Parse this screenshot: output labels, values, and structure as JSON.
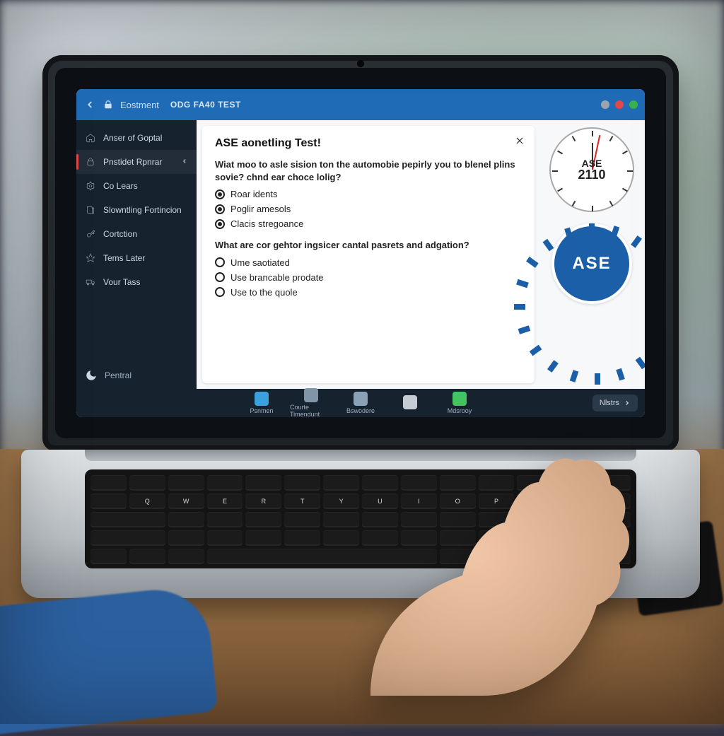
{
  "header": {
    "crumb": "Eostment",
    "title": "ODG FA40 TEST"
  },
  "window": {
    "controls": [
      "minimize",
      "maximize",
      "close"
    ]
  },
  "sidebar": {
    "items": [
      {
        "icon": "home-icon",
        "label": "Anser of Goptal"
      },
      {
        "icon": "lock-icon",
        "label": "Pnstidet Rpnrar",
        "active": true,
        "chevron": true
      },
      {
        "icon": "gear-icon",
        "label": "Co Lears"
      },
      {
        "icon": "book-icon",
        "label": "Slowntling Fortincion"
      },
      {
        "icon": "key-icon",
        "label": "Cortction"
      },
      {
        "icon": "star-icon",
        "label": "Tems Later"
      },
      {
        "icon": "truck-icon",
        "label": "Vour Tass"
      }
    ],
    "footer": {
      "icon": "moon-icon",
      "label": "Pentral"
    }
  },
  "card": {
    "title": "ASE aonetling Test!",
    "questions": [
      {
        "text": "Wiat moo to asle sision ton the automobie pepirly you to blenel plins sovie? chnd ear choce lolig?",
        "options": [
          {
            "label": "Roar idents",
            "checked": true
          },
          {
            "label": "Poglir amesols",
            "checked": true
          },
          {
            "label": "Clacis stregoance",
            "checked": true
          }
        ]
      },
      {
        "text": "What are cor gehtor ingsicer cantal pasrets and adgation?",
        "options": [
          {
            "label": "Ume saotiated",
            "checked": false
          },
          {
            "label": "Use brancable prodate",
            "checked": false
          },
          {
            "label": "Use to the quole",
            "checked": false
          }
        ]
      }
    ]
  },
  "clock": {
    "label1": "ASE",
    "label2": "2110"
  },
  "seal": {
    "label": "ASE"
  },
  "taskbar": {
    "apps": [
      {
        "icon": "folder-icon",
        "label": "Psnmen",
        "color": "#3aa1de"
      },
      {
        "icon": "calendar-icon",
        "label": "Courte Timendunt",
        "color": "#8095a8"
      },
      {
        "icon": "list-icon",
        "label": "Bswodere",
        "color": "#8aa1b6"
      },
      {
        "icon": "pin-icon",
        "label": "",
        "color": "#c5cdd4"
      },
      {
        "icon": "chat-icon",
        "label": "Mdsrooy",
        "color": "#43c463"
      }
    ],
    "next_label": "Nlstrs"
  },
  "keyboard": {
    "row2": [
      "Q",
      "W",
      "E",
      "R",
      "T",
      "Y",
      "U",
      "I",
      "O",
      "P",
      "[",
      "]",
      "\\"
    ]
  },
  "colors": {
    "brand": "#1f6bb6",
    "sidebar": "#17222f",
    "accent": "#e24848",
    "seal": "#1b5fa8"
  }
}
